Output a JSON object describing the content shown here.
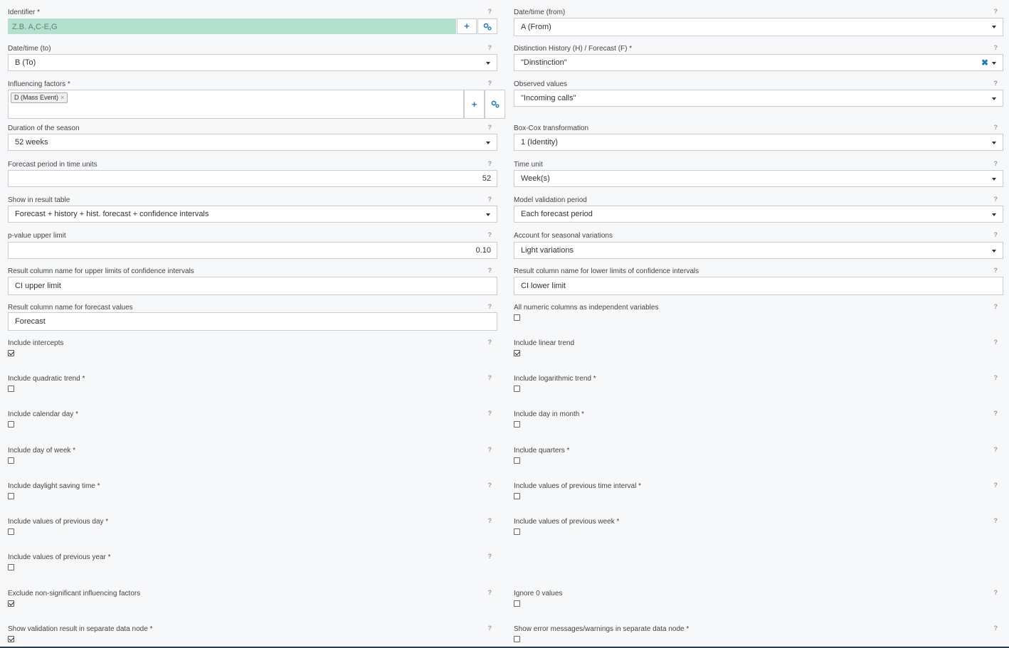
{
  "help_glyph": "?",
  "fields": {
    "identifier": {
      "label": "Identifier *",
      "placeholder": "Z.B. A,C-E,G",
      "add_icon": "plus-icon",
      "config_icon": "gears-icon"
    },
    "datetime_from": {
      "label": "Date/time (from)",
      "value": "A (From)"
    },
    "datetime_to": {
      "label": "Date/time (to)",
      "value": "B (To)"
    },
    "distinction": {
      "label": "Distinction History (H) / Forecast (F) *",
      "value": "\"Dinstinction\"",
      "clear_icon": "close-icon"
    },
    "influencing_factors": {
      "label": "Influencing factors *",
      "tags": [
        "D (Mass Event)"
      ],
      "tag_remove_glyph": "×"
    },
    "observed_values": {
      "label": "Observed values",
      "value": "\"Incoming calls\""
    },
    "season_duration": {
      "label": "Duration of the season",
      "value": "52 weeks"
    },
    "box_cox": {
      "label": "Box-Cox transformation",
      "value": "1 (Identity)"
    },
    "forecast_period": {
      "label": "Forecast period in time units",
      "value": "52"
    },
    "time_unit": {
      "label": "Time unit",
      "value": "Week(s)"
    },
    "show_in_result": {
      "label": "Show in result table",
      "value": "Forecast + history + hist. forecast + confidence intervals"
    },
    "model_validation": {
      "label": "Model validation period",
      "value": "Each forecast period"
    },
    "p_value": {
      "label": "p-value upper limit",
      "value": "0.10"
    },
    "seasonal_variations": {
      "label": "Account for seasonal variations",
      "value": "Light variations"
    },
    "ci_upper_name": {
      "label": "Result column name for upper limits of confidence intervals",
      "value": "CI upper limit"
    },
    "ci_lower_name": {
      "label": "Result column name for lower limits of confidence intervals",
      "value": "CI lower limit"
    },
    "forecast_col_name": {
      "label": "Result column name for forecast values",
      "value": "Forecast"
    }
  },
  "checkboxes": {
    "all_numeric": {
      "label": "All numeric columns as independent variables",
      "checked": false
    },
    "intercepts": {
      "label": "Include intercepts",
      "checked": true
    },
    "linear_trend": {
      "label": "Include linear trend",
      "checked": true
    },
    "quadratic_trend": {
      "label": "Include quadratic trend *",
      "checked": false
    },
    "log_trend": {
      "label": "Include logarithmic trend *",
      "checked": false
    },
    "calendar_day": {
      "label": "Include calendar day *",
      "checked": false
    },
    "day_in_month": {
      "label": "Include day in month *",
      "checked": false
    },
    "day_of_week": {
      "label": "Include day of week *",
      "checked": false
    },
    "quarters": {
      "label": "Include quarters *",
      "checked": false
    },
    "dst": {
      "label": "Include daylight saving time *",
      "checked": false
    },
    "prev_interval": {
      "label": "Include values of previous time interval *",
      "checked": false
    },
    "prev_day": {
      "label": "Include values of previous day *",
      "checked": false
    },
    "prev_week": {
      "label": "Include values of previous week *",
      "checked": false
    },
    "prev_year": {
      "label": "Include values of previous year *",
      "checked": false
    },
    "exclude_nonsig": {
      "label": "Exclude non-significant influencing factors",
      "checked": true
    },
    "ignore_zero": {
      "label": "Ignore 0 values",
      "checked": false
    },
    "validation_separate": {
      "label": "Show validation result in separate data node *",
      "checked": true
    },
    "errors_separate": {
      "label": "Show error messages/warnings in separate data node *",
      "checked": false
    }
  }
}
